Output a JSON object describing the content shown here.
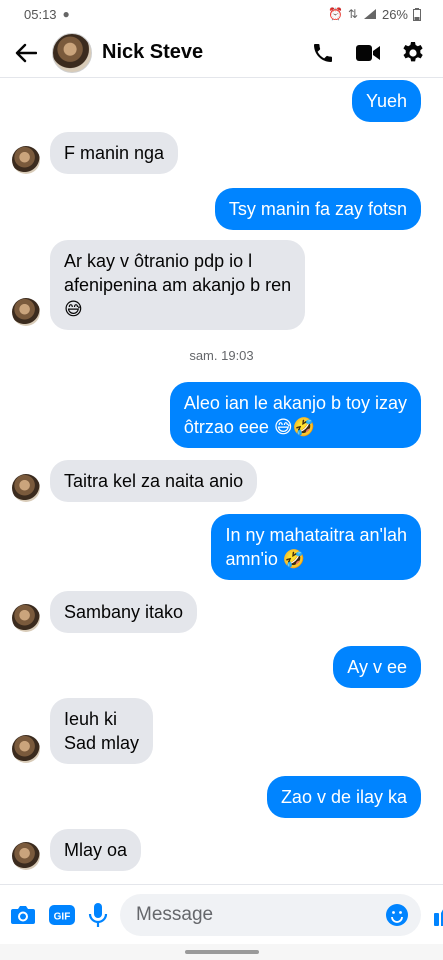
{
  "status_bar": {
    "time": "05:13",
    "battery": "26%"
  },
  "header": {
    "contact_name": "Nick Steve",
    "back_icon": "arrow-left-icon",
    "call_icon": "phone-icon",
    "video_icon": "video-camera-icon",
    "settings_icon": "gear-icon"
  },
  "thread": {
    "messages": [
      {
        "from": "me",
        "text": "Yueh"
      },
      {
        "from": "them",
        "text": "F manin nga"
      },
      {
        "from": "me",
        "text": "Tsy manin fa zay fotsn"
      },
      {
        "from": "them",
        "text": "Ar kay v ôtranio pdp io l\nafenipenina am akanjo b ren\n😅"
      },
      {
        "from": "me",
        "text": "Aleo ian le akanjo b toy izay\nôtrzao eee 😅🤣"
      },
      {
        "from": "them",
        "text": "Taitra kel za naita anio"
      },
      {
        "from": "me",
        "text": "In ny mahataitra an'lah\namn'io 🤣"
      },
      {
        "from": "them",
        "text": "Sambany itako"
      },
      {
        "from": "me",
        "text": "Ay v ee"
      },
      {
        "from": "them",
        "text": "Ieuh ki\nSad mlay"
      },
      {
        "from": "me",
        "text": "Zao v de ilay ka"
      },
      {
        "from": "them",
        "text": "Mlay oa"
      }
    ],
    "timestamp": "sam. 19:03"
  },
  "composer": {
    "placeholder": "Message",
    "icons": [
      "camera-icon",
      "gif-icon",
      "microphone-icon",
      "emoji-icon",
      "thumbs-up-icon"
    ]
  },
  "colors": {
    "accent": "#0084ff",
    "incoming_bubble": "#e4e6eb",
    "outgoing_text": "#ffffff"
  }
}
